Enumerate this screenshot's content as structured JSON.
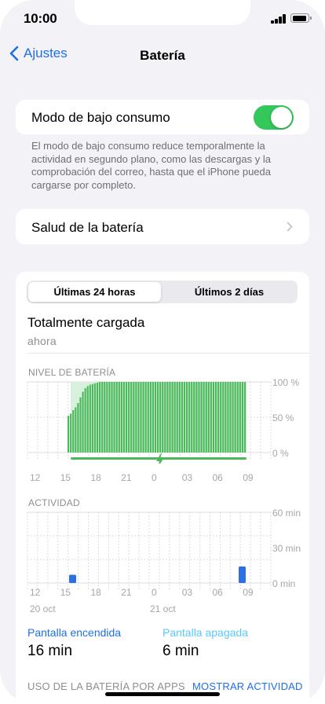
{
  "status_bar": {
    "time": "10:00"
  },
  "nav": {
    "back_label": "Ajustes",
    "title": "Batería"
  },
  "low_power": {
    "label": "Modo de bajo consumo",
    "enabled": true,
    "footnote": "El modo de bajo consumo reduce temporalmente la actividad en segundo plano, como las descargas y la comprobación del correo, hasta que el iPhone pueda cargarse por completo."
  },
  "battery_health": {
    "label": "Salud de la batería"
  },
  "usage": {
    "tabs": [
      {
        "label": "Últimas 24 horas",
        "selected": true
      },
      {
        "label": "Últimos 2 días",
        "selected": false
      }
    ],
    "status_title": "Totalmente cargada",
    "status_sub": "ahora",
    "colors": {
      "bar": "#4cb85c",
      "shade": "#d8f1dc",
      "activity_bar": "#2f6fe4",
      "grid": "#dcdce0",
      "screen_on": "#1f6fe5",
      "screen_off": "#5ac8fa"
    },
    "x_ticks": [
      "12",
      "15",
      "18",
      "21",
      "0",
      "03",
      "06",
      "09"
    ],
    "day_labels": [
      "20 oct",
      "21 oct"
    ],
    "battery_chart": {
      "label": "NIVEL DE BATERÍA",
      "y_ticks": [
        "100 %",
        "50 %",
        "0 %"
      ],
      "charging_icon": "bolt-icon",
      "levels": [
        52,
        55,
        60,
        64,
        70,
        78,
        86,
        91,
        94,
        96,
        97,
        98,
        99,
        100,
        100,
        100,
        100,
        100,
        100,
        100,
        100,
        100,
        100,
        100,
        100,
        100,
        100,
        100,
        100,
        100,
        100,
        100,
        100,
        100,
        100,
        100,
        100,
        100,
        100,
        100,
        100,
        100,
        100,
        100,
        100,
        100,
        100,
        100,
        100,
        100,
        100,
        100,
        100,
        100,
        100,
        100,
        100,
        100,
        100,
        100,
        100,
        100,
        100,
        100,
        100,
        100,
        100,
        100,
        100,
        100,
        100,
        100,
        100,
        100
      ]
    },
    "activity_chart": {
      "label": "ACTIVIDAD",
      "y_ticks": [
        "60 min",
        "30 min",
        "0 min"
      ],
      "bars": [
        {
          "hour_index": 1,
          "minutes": 7
        },
        {
          "hour_index": 21,
          "minutes": 14
        }
      ]
    },
    "screen_on": {
      "label": "Pantalla encendida",
      "value": "16 min"
    },
    "screen_off": {
      "label": "Pantalla apagada",
      "value": "6 min"
    },
    "apps_header": "USO DE LA BATERÍA POR APPS",
    "show_activity": "MOSTRAR ACTIVIDAD"
  }
}
